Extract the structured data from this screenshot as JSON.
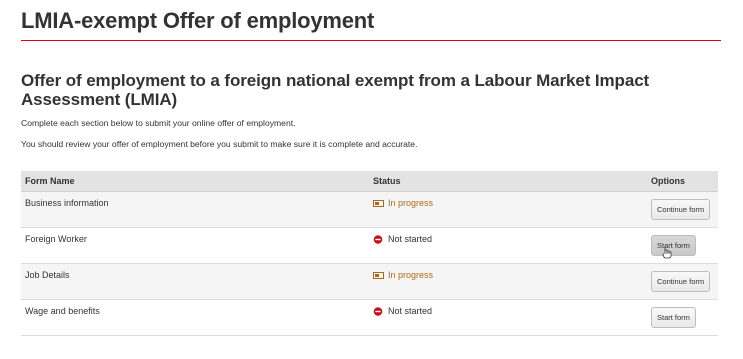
{
  "header": {
    "page_title": "LMIA-exempt Offer of employment"
  },
  "intro": {
    "heading": "Offer of employment to a foreign national exempt from a Labour Market Impact Assessment (LMIA)",
    "paragraph_1": "Complete each section below to submit your online offer of employment.",
    "paragraph_2": "You should review your offer of employment before you submit to make sure it is complete and accurate."
  },
  "table": {
    "headers": {
      "name": "Form Name",
      "status": "Status",
      "options": "Options"
    },
    "rows": [
      {
        "name": "Business information",
        "status": "In progress",
        "status_icon": "in-progress-icon",
        "option": "Continue form"
      },
      {
        "name": "Foreign Worker",
        "status": "Not started",
        "status_icon": "not-started-icon",
        "option": "Start form"
      },
      {
        "name": "Job Details",
        "status": "In progress",
        "status_icon": "in-progress-icon",
        "option": "Continue form"
      },
      {
        "name": "Wage and benefits",
        "status": "Not started",
        "status_icon": "not-started-icon",
        "option": "Start form"
      }
    ]
  },
  "colors": {
    "accent_rule": "#d3080c",
    "in_progress": "#a86b1c",
    "not_started_icon": "#c1121f",
    "header_bg": "#e3e3e3"
  }
}
